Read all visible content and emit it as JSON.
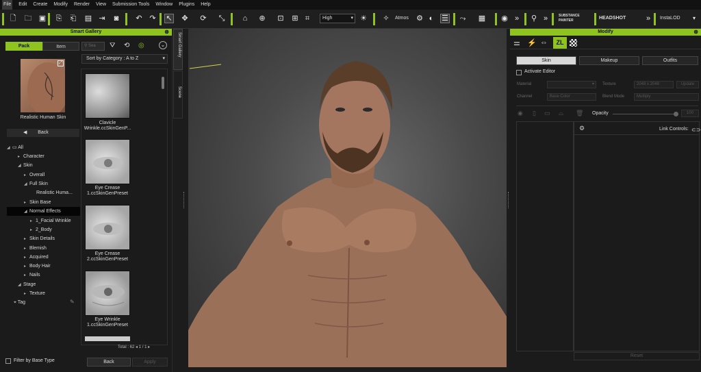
{
  "menu": [
    "File",
    "Edit",
    "Create",
    "Modify",
    "Render",
    "View",
    "Submission Tools",
    "Window",
    "Plugins",
    "Help"
  ],
  "toolbar": {
    "quality": "High",
    "atmos": "Atmos",
    "substance": "SUBSTANCE PAINTER",
    "headshot": "HEADSHOT",
    "instalod": "InstaLOD"
  },
  "smart_gallery": {
    "title": "Smart Gallery",
    "tab_pack": "Pack",
    "tab_item": "Item",
    "search_placeholder": "Sea",
    "sort": "Sort by Category : A to Z",
    "preview_label": "Realistic Human Skin",
    "back": "Back",
    "tree": [
      "All",
      "Character",
      "Skin",
      "Overall",
      "Full Skin",
      "Realistic Huma...",
      "Skin Base",
      "Normal Effects",
      "1_Facial Wrinkle",
      "2_Body",
      "Skin Details",
      "Blemish",
      "Acquired",
      "Body Hair",
      "Nails",
      "Stage",
      "Texture",
      "Tag"
    ],
    "items": [
      "Clavicle Wrinkle.ccSkinGenP...",
      "Eye Crease 1.ccSkinGenPreset",
      "Eye Crease 2.ccSkinGenPreset",
      "Eye Wrinkle 1.ccSkinGenPreset"
    ],
    "total": "Total : 62",
    "page_current": "1",
    "page_sep": "/",
    "page_total": "1",
    "filter": "Filter by Base Type",
    "back_btn": "Back",
    "apply_btn": "Apply"
  },
  "side_tabs": {
    "gallery": "Smart Gallery",
    "scene": "Scene"
  },
  "modify": {
    "title": "Modify",
    "tabs": [
      "Skin",
      "Makeup",
      "Outfits"
    ],
    "activate": "Activate Editor",
    "material": "Material",
    "texture": "Texture",
    "texture_size": "2048 x 2048",
    "update": "Update",
    "channel": "Channel",
    "channel_value": "Base Color",
    "blend": "Blend Mode",
    "blend_value": "Multiply",
    "opacity": "Opacity",
    "opacity_value": "100",
    "link": "Link Controls:",
    "reset": "Reset"
  },
  "colors": {
    "accent": "#8fc31f"
  }
}
